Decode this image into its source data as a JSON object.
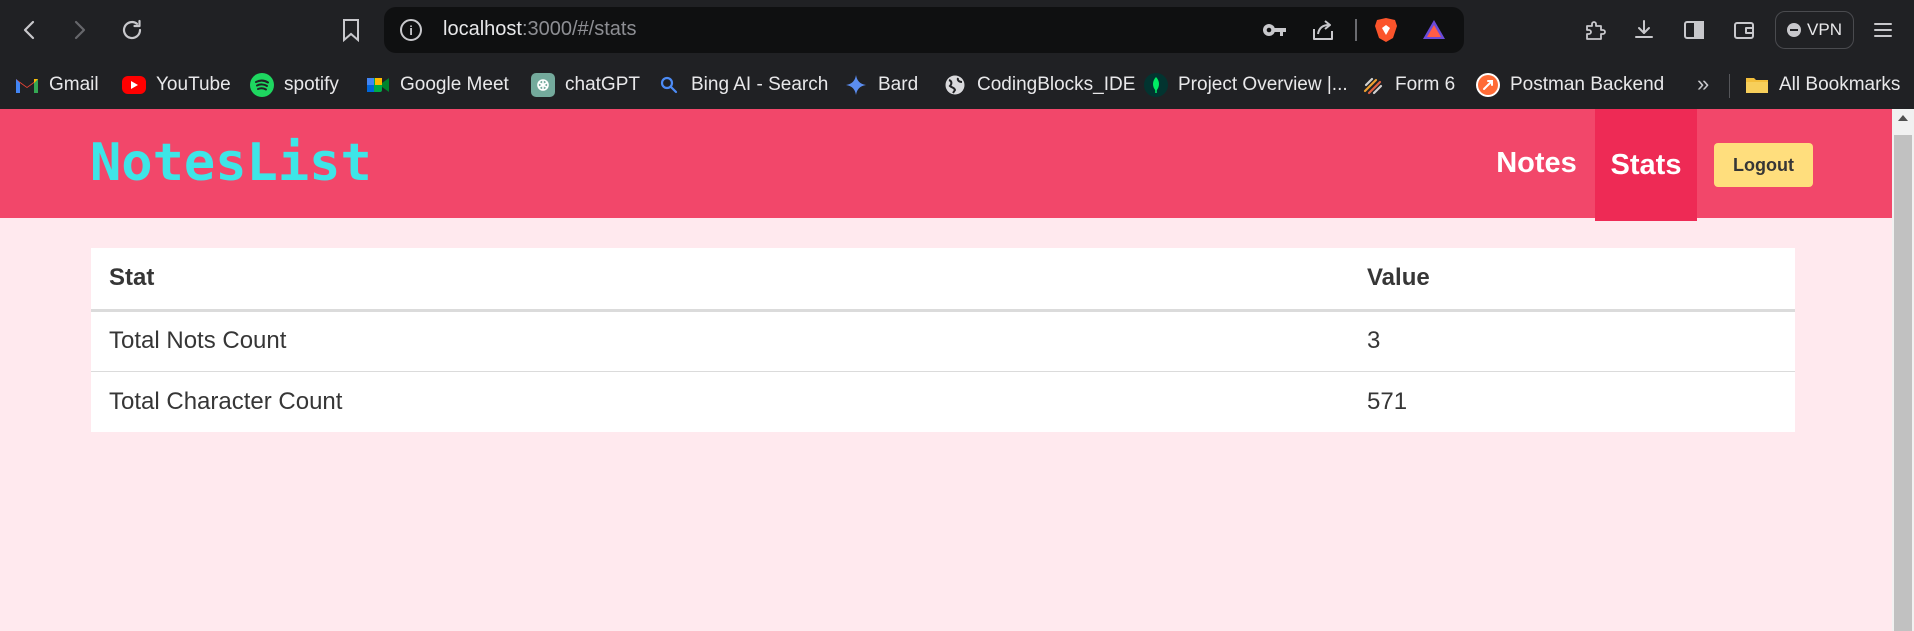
{
  "browser": {
    "url_host": "localhost",
    "url_path": ":3000/#/stats",
    "vpn_label": "VPN",
    "bookmarks": [
      {
        "label": "Gmail",
        "icon": "gmail-icon"
      },
      {
        "label": "YouTube",
        "icon": "youtube-icon"
      },
      {
        "label": "spotify",
        "icon": "spotify-icon"
      },
      {
        "label": "Google Meet",
        "icon": "google-meet-icon"
      },
      {
        "label": "chatGPT",
        "icon": "chatgpt-icon"
      },
      {
        "label": "Bing AI - Search",
        "icon": "search-icon"
      },
      {
        "label": "Bard",
        "icon": "bard-sparkle-icon"
      },
      {
        "label": "CodingBlocks_IDE",
        "icon": "globe-icon"
      },
      {
        "label": "Project Overview |...",
        "icon": "mongodb-leaf-icon"
      },
      {
        "label": "Form 6",
        "icon": "form-icon"
      },
      {
        "label": "Postman Backend",
        "icon": "postman-icon"
      }
    ],
    "more_label": "»",
    "all_bookmarks_label": "All Bookmarks"
  },
  "app": {
    "logo": "NotesList",
    "nav": {
      "notes": "Notes",
      "stats": "Stats",
      "active": "Stats"
    },
    "logout_label": "Logout"
  },
  "stats_table": {
    "headers": [
      "Stat",
      "Value"
    ],
    "rows": [
      {
        "stat": "Total Nots Count",
        "value": "3"
      },
      {
        "stat": "Total Character Count",
        "value": "571"
      }
    ]
  },
  "colors": {
    "header_bg": "#f2476a",
    "active_nav_bg": "#ee2a55",
    "logo_color": "#3ee5e7",
    "page_bg": "#ffe9ee",
    "logout_bg": "#ffde7d"
  }
}
